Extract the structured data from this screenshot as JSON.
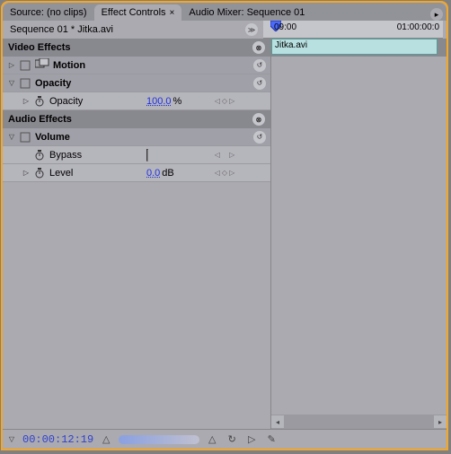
{
  "tabs": {
    "source": "Source: (no clips)",
    "effect_controls": "Effect Controls",
    "audio_mixer": "Audio Mixer: Sequence 01"
  },
  "sequence_label": "Sequence 01 * Jitka.avi",
  "sections": {
    "video": "Video Effects",
    "audio": "Audio Effects"
  },
  "rows": {
    "motion": "Motion",
    "opacity": "Opacity",
    "opacity_prop": "Opacity",
    "opacity_val": "100.0",
    "opacity_unit": "%",
    "volume": "Volume",
    "bypass": "Bypass",
    "level": "Level",
    "level_val": "0.0",
    "level_unit": "dB"
  },
  "timeline": {
    "t0": "09:00",
    "t1": "01:00:00:0",
    "clip": "Jitka.avi"
  },
  "footer": {
    "timecode": "00:00:12:19"
  }
}
